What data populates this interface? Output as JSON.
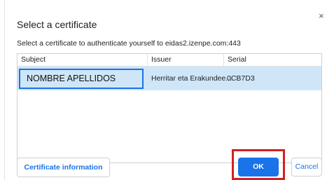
{
  "dialog": {
    "title": "Select a certificate",
    "subtitle": "Select a certificate to authenticate yourself to eidas2.izenpe.com:443",
    "close_glyph": "×"
  },
  "table": {
    "headers": [
      "Subject",
      "Issuer",
      "Serial"
    ],
    "rows": [
      {
        "subject": "NOMBRE APELLIDOS",
        "issuer": "Herritar eta Erakundee...",
        "serial": "0CB7D3",
        "selected": true
      }
    ]
  },
  "buttons": {
    "certificate_info": "Certificate information",
    "ok": "OK",
    "cancel": "Cancel"
  },
  "colors": {
    "accent": "#1a73e8",
    "selected_row": "#cfe6f8",
    "highlight_box": "#d32020"
  }
}
